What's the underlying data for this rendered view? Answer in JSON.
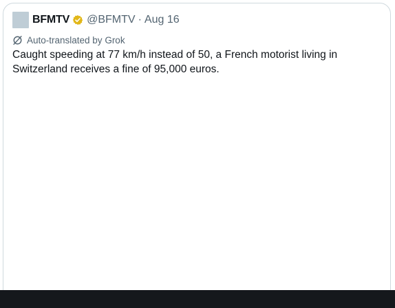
{
  "tweet": {
    "display_name": "BFMTV",
    "handle": "@BFMTV",
    "separator": "·",
    "date": "Aug 16",
    "verified_icon": "verified-badge-icon",
    "translation_notice": "Auto-translated by Grok",
    "translation_icon": "translate-icon",
    "text": "Caught speeding at 77 km/h instead of 50, a French motorist living in Switzerland receives a fine of 95,000 euros."
  },
  "colors": {
    "verified_gold": "#e2b719",
    "secondary_text": "#536471",
    "primary_text": "#0f1419",
    "card_border": "#cfd9de",
    "bottom_bar": "#15181c"
  }
}
